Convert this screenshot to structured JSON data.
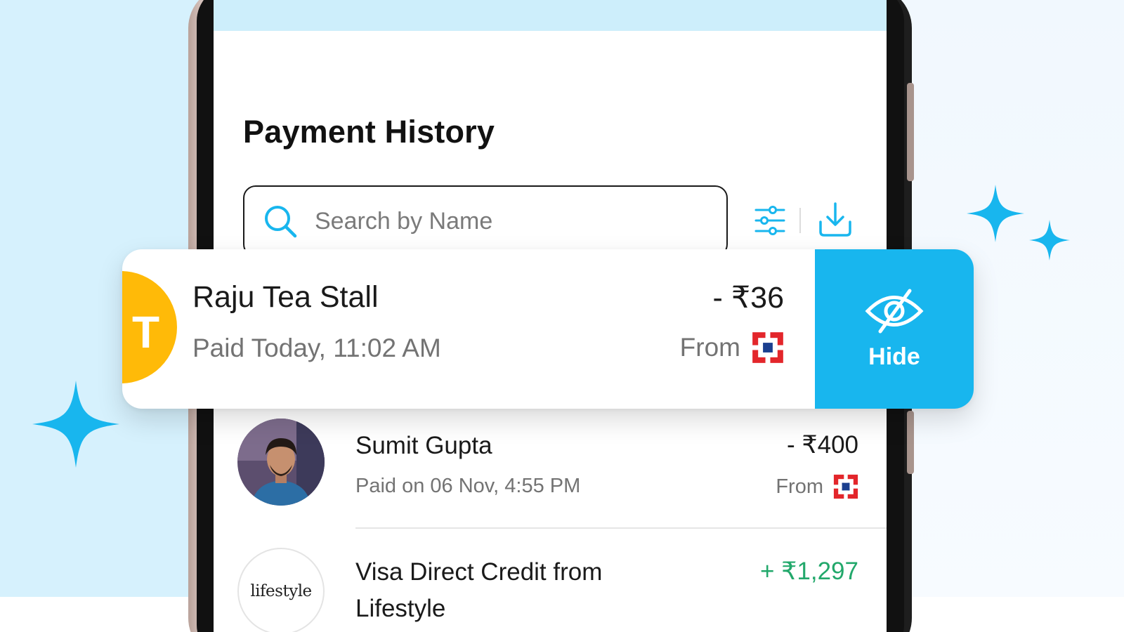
{
  "screen": {
    "title": "Payment History"
  },
  "search": {
    "placeholder": "Search by Name",
    "value": ""
  },
  "toolbar": {
    "filter_icon": "filter-sliders-icon",
    "download_icon": "download-icon"
  },
  "highlighted_transaction": {
    "avatar_letter": "T",
    "name": "Raju Tea Stall",
    "subtitle": "Paid Today, 11:02 AM",
    "amount": "- ₹36",
    "from_label": "From",
    "source_icon": "bank-logo-icon",
    "action": {
      "label": "Hide",
      "icon": "eye-slash-icon"
    }
  },
  "transactions": [
    {
      "name": "Sumit Gupta",
      "subtitle": "Paid on 06 Nov, 4:55 PM",
      "amount": "- ₹400",
      "from_label": "From",
      "source_icon": "bank-logo-icon",
      "avatar": "profile-photo"
    },
    {
      "name_line1": "Visa Direct Credit from",
      "name_line2": "Lifestyle",
      "amount": "+ ₹1,297",
      "logo_text": "lifestyle"
    }
  ],
  "colors": {
    "accent": "#18b6ee",
    "avatar_yellow": "#ffba08",
    "credit_green": "#22a86b",
    "bank_red": "#e3262b",
    "bank_blue": "#1b3f8f",
    "left_bg": "#d6f1fd"
  }
}
